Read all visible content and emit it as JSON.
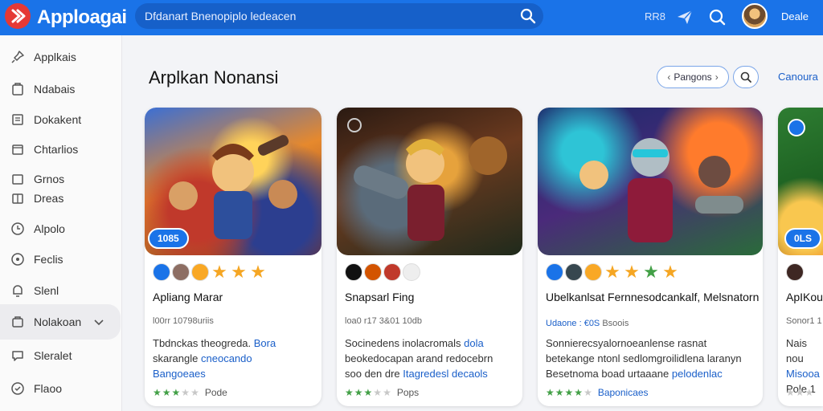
{
  "header": {
    "app_title": "Apploagai",
    "search_placeholder": "Dfdanart Bnenopiplo ledeacen",
    "label": "RR8",
    "user_name": "Deale"
  },
  "sidebar": {
    "items": [
      {
        "label": "Applkais",
        "icon": "pin-icon"
      },
      {
        "label": "Ndabais",
        "icon": "folder-icon"
      },
      {
        "label": "Dokakent",
        "icon": "document-icon"
      },
      {
        "label": "Chtarlios",
        "icon": "calendar-icon"
      },
      {
        "label": "Grnos",
        "icon": "grid-icon"
      },
      {
        "label": "Dreas",
        "icon": "list-icon"
      },
      {
        "label": "Alpolo",
        "icon": "clock-icon"
      },
      {
        "label": "Feclis",
        "icon": "circle-icon"
      },
      {
        "label": "Slenl",
        "icon": "bell-icon"
      },
      {
        "label": "Nolakoan",
        "icon": "bag-icon"
      },
      {
        "label": "Sleralet",
        "icon": "chat-icon"
      },
      {
        "label": "Flaoo",
        "icon": "shield-icon"
      }
    ]
  },
  "main": {
    "title": "Arplkan Nonansi",
    "pill_button": "Pangons",
    "link_button": "Canoura"
  },
  "cards": [
    {
      "badge": "1085",
      "title": "Apliang Marar",
      "meta": "l00rr 10798uriis",
      "meta_blue": "",
      "desc_1": "Tbdnckas theogreda.",
      "desc_1_blue": "Bora",
      "desc_2": "skarangle",
      "desc_2_blue": "cneocando",
      "desc_3": "",
      "desc_3_blue": "Bangoeaes",
      "stars_filled": 3,
      "rating_text": "Pode"
    },
    {
      "badge": "",
      "title": "Snapsarl Fing",
      "meta": "loa0 r17 3&01 10db",
      "meta_blue": "",
      "desc_1": "Socinedens inolacromals",
      "desc_1_blue": "dola",
      "desc_2": "beokedocapan arand redocebrn",
      "desc_2_blue": "",
      "desc_3": "soo den dre",
      "desc_3_blue": "Itagredesl decaols",
      "stars_filled": 3,
      "rating_text": "Pops"
    },
    {
      "badge": "",
      "title": "Ubelkanlsat Fernnesodcankalf, Melsnatorn",
      "meta": "",
      "meta_blue": "Udaone : €0S",
      "meta_2": "Bsoois",
      "desc_1": "Sonnierecsyalornoeanlense rasnat",
      "desc_1_blue": "",
      "desc_2": "betekange ntonl sedlomgroilidlena laranyn",
      "desc_2_blue": "",
      "desc_3": "Besetnoma boad urtaaane",
      "desc_3_blue": "pelodenlac",
      "stars_filled": 4,
      "rating_text": "Baponicaes"
    },
    {
      "badge": "0LS",
      "title": "ApIKou",
      "meta": "Sonor1 1",
      "meta_blue": "",
      "desc_1": "Nais nou",
      "desc_1_blue": "",
      "desc_2": "",
      "desc_2_blue": "Misooa",
      "desc_3": "Pole 1",
      "desc_3_blue": "",
      "stars_filled": 0,
      "rating_text": ""
    }
  ]
}
